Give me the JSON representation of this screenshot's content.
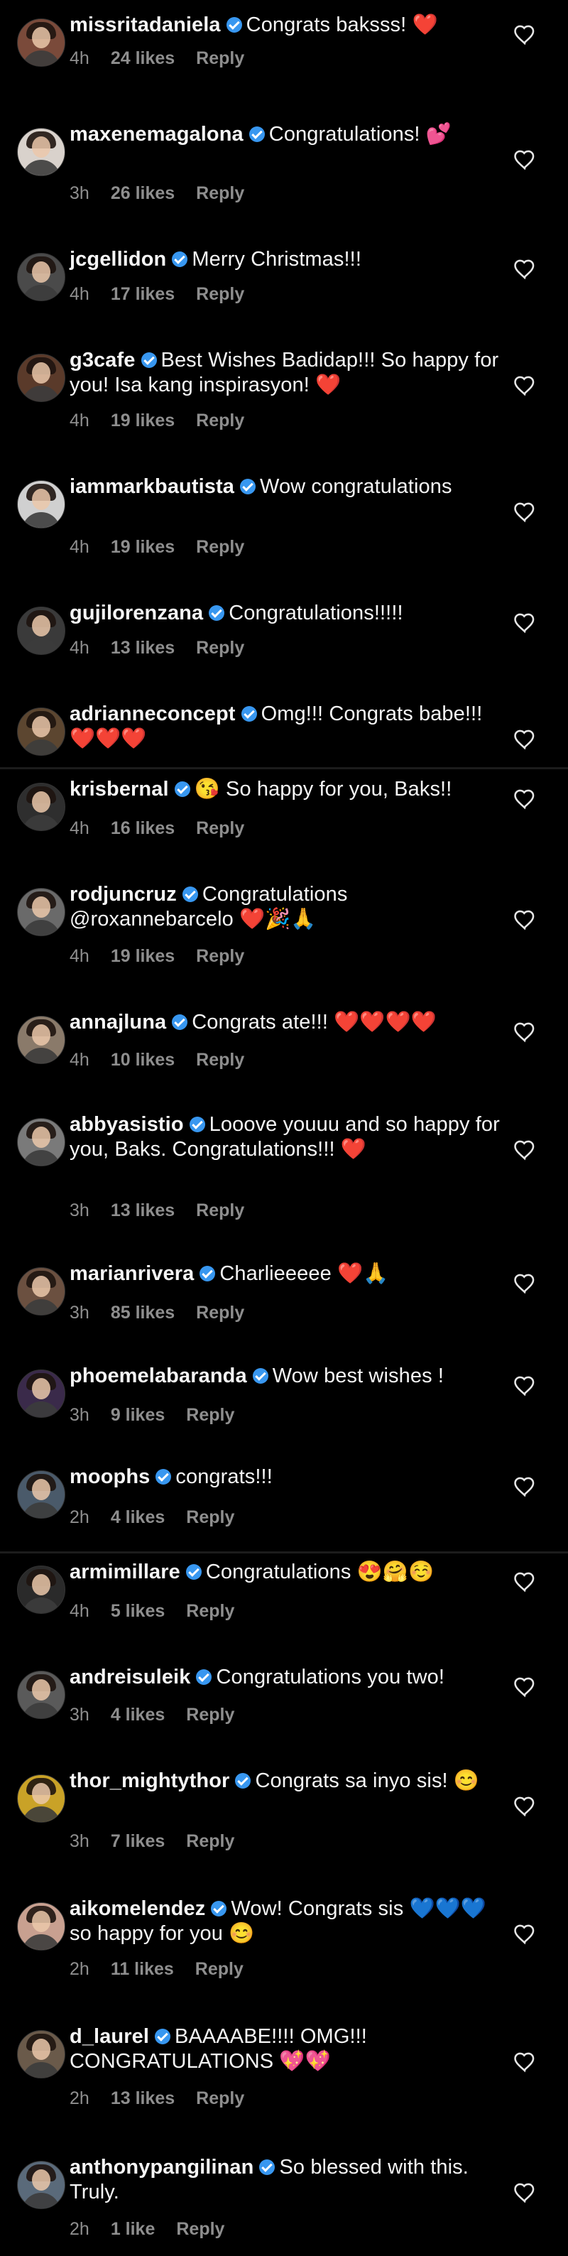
{
  "comments": [
    {
      "user": "missritadaniela",
      "text": "Congrats baksss! ❤️",
      "time": "4h",
      "likes": "24 likes",
      "reply": "Reply",
      "avatar_icon": "avatar-icon",
      "avatar_color": "#7a4a3a"
    },
    {
      "user": "maxenemagalona",
      "text": "Congratulations! 💕",
      "time": "3h",
      "likes": "26 likes",
      "reply": "Reply",
      "avatar_icon": "avatar-icon",
      "avatar_color": "#d9d2cc"
    },
    {
      "user": "jcgellidon",
      "text": "Merry Christmas!!!",
      "time": "4h",
      "likes": "17 likes",
      "reply": "Reply",
      "avatar_icon": "avatar-icon",
      "avatar_color": "#4a4a4a"
    },
    {
      "user": "g3cafe",
      "text": "Best Wishes Badidap!!! So happy for you! Isa kang inspirasyon! ❤️",
      "time": "4h",
      "likes": "19 likes",
      "reply": "Reply",
      "avatar_icon": "avatar-icon",
      "avatar_color": "#5a3a2a"
    },
    {
      "user": "iammarkbautista",
      "text": "Wow congratulations",
      "time": "4h",
      "likes": "19 likes",
      "reply": "Reply",
      "avatar_icon": "avatar-icon",
      "avatar_color": "#d0d0d0"
    },
    {
      "user": "gujilorenzana",
      "text": "Congratulations!!!!!",
      "time": "4h",
      "likes": "13 likes",
      "reply": "Reply",
      "avatar_icon": "avatar-icon",
      "avatar_color": "#3a3a3a"
    },
    {
      "user": "adrianneconcept",
      "text": "Omg!!! Congrats babe!!! ❤️❤️❤️",
      "time": "",
      "likes": "",
      "reply": "",
      "avatar_icon": "avatar-icon",
      "avatar_color": "#5c4630"
    },
    {
      "user": "krisbernal",
      "text": "😘 So happy for you, Baks!!",
      "time": "4h",
      "likes": "16 likes",
      "reply": "Reply",
      "avatar_icon": "avatar-icon",
      "avatar_color": "#2e2e2e"
    },
    {
      "user": "rodjuncruz",
      "text": "Congratulations @roxannebarcelo ❤️🎉🙏",
      "time": "4h",
      "likes": "19 likes",
      "reply": "Reply",
      "avatar_icon": "avatar-icon",
      "avatar_color": "#6a6a6a"
    },
    {
      "user": "annajluna",
      "text": "Congrats ate!!! ❤️❤️❤️❤️",
      "time": "4h",
      "likes": "10 likes",
      "reply": "Reply",
      "avatar_icon": "avatar-icon",
      "avatar_color": "#8a7a6a"
    },
    {
      "user": "abbyasistio",
      "text": "Looove youuu and so happy for you, Baks. Congratulations!!! ❤️",
      "time": "3h",
      "likes": "13 likes",
      "reply": "Reply",
      "avatar_icon": "avatar-icon",
      "avatar_color": "#7a7a7a"
    },
    {
      "user": "marianrivera",
      "text": "Charlieeeee ❤️🙏",
      "time": "3h",
      "likes": "85 likes",
      "reply": "Reply",
      "avatar_icon": "avatar-icon",
      "avatar_color": "#6b5040"
    },
    {
      "user": "phoemelabaranda",
      "text": "Wow best wishes !",
      "time": "3h",
      "likes": "9 likes",
      "reply": "Reply",
      "avatar_icon": "avatar-icon",
      "avatar_color": "#3a2a4a"
    },
    {
      "user": "moophs",
      "text": "congrats!!!",
      "time": "2h",
      "likes": "4 likes",
      "reply": "Reply",
      "avatar_icon": "avatar-icon",
      "avatar_color": "#4a5a6a"
    },
    {
      "user": "armimillare",
      "text": "Congratulations 😍🤗☺️",
      "time": "4h",
      "likes": "5 likes",
      "reply": "Reply",
      "avatar_icon": "avatar-icon",
      "avatar_color": "#2a2a2a"
    },
    {
      "user": "andreisuleik",
      "text": "Congratulations you two!",
      "time": "3h",
      "likes": "4 likes",
      "reply": "Reply",
      "avatar_icon": "avatar-icon",
      "avatar_color": "#5a5a5a"
    },
    {
      "user": "thor_mightythor",
      "text": "Congrats sa inyo sis! 😊",
      "time": "3h",
      "likes": "7 likes",
      "reply": "Reply",
      "avatar_icon": "avatar-icon",
      "avatar_color": "#c9a227"
    },
    {
      "user": "aikomelendez",
      "text": "Wow! Congrats sis 💙💙💙 so happy for you 😊",
      "time": "2h",
      "likes": "11 likes",
      "reply": "Reply",
      "avatar_icon": "avatar-icon",
      "avatar_color": "#c8a090"
    },
    {
      "user": "d_laurel",
      "text": "BAAAABE!!!! OMG!!! CONGRATULATIONS 💖💖",
      "time": "2h",
      "likes": "13 likes",
      "reply": "Reply",
      "avatar_icon": "avatar-icon",
      "avatar_color": "#6a5a4a"
    },
    {
      "user": "anthonypangilinan",
      "text": "So blessed with this. Truly.",
      "time": "2h",
      "likes": "1 like",
      "reply": "Reply",
      "avatar_icon": "avatar-icon",
      "avatar_color": "#5a6a7a"
    }
  ],
  "colors": {
    "background": "#000000",
    "text": "#f5f5f5",
    "meta": "#8e8e8e",
    "verified": "#3897f0"
  }
}
